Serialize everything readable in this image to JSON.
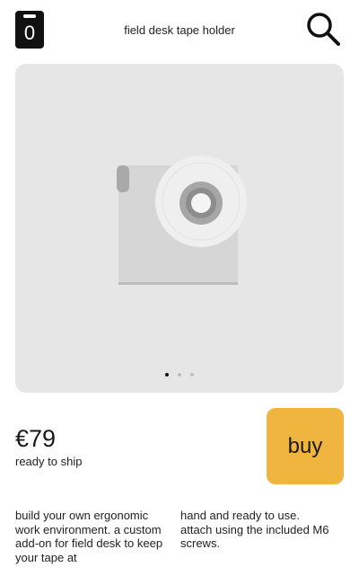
{
  "header": {
    "cart_count": "0",
    "title": "field desk tape holder",
    "search_icon": "search-icon"
  },
  "gallery": {
    "image": "tape-holder-product-image",
    "slides": 3,
    "active_slide": 1
  },
  "product": {
    "price": "€79",
    "shipping": "ready to ship",
    "buy_label": "buy"
  },
  "description": {
    "col1": "build your own ergonomic work environment. a custom add-on for field desk to keep your tape at",
    "col2": "hand and ready to use. attach using the included M6 screws."
  },
  "colors": {
    "accent": "#f0b53f",
    "gallery_bg": "#e6e6e6"
  }
}
